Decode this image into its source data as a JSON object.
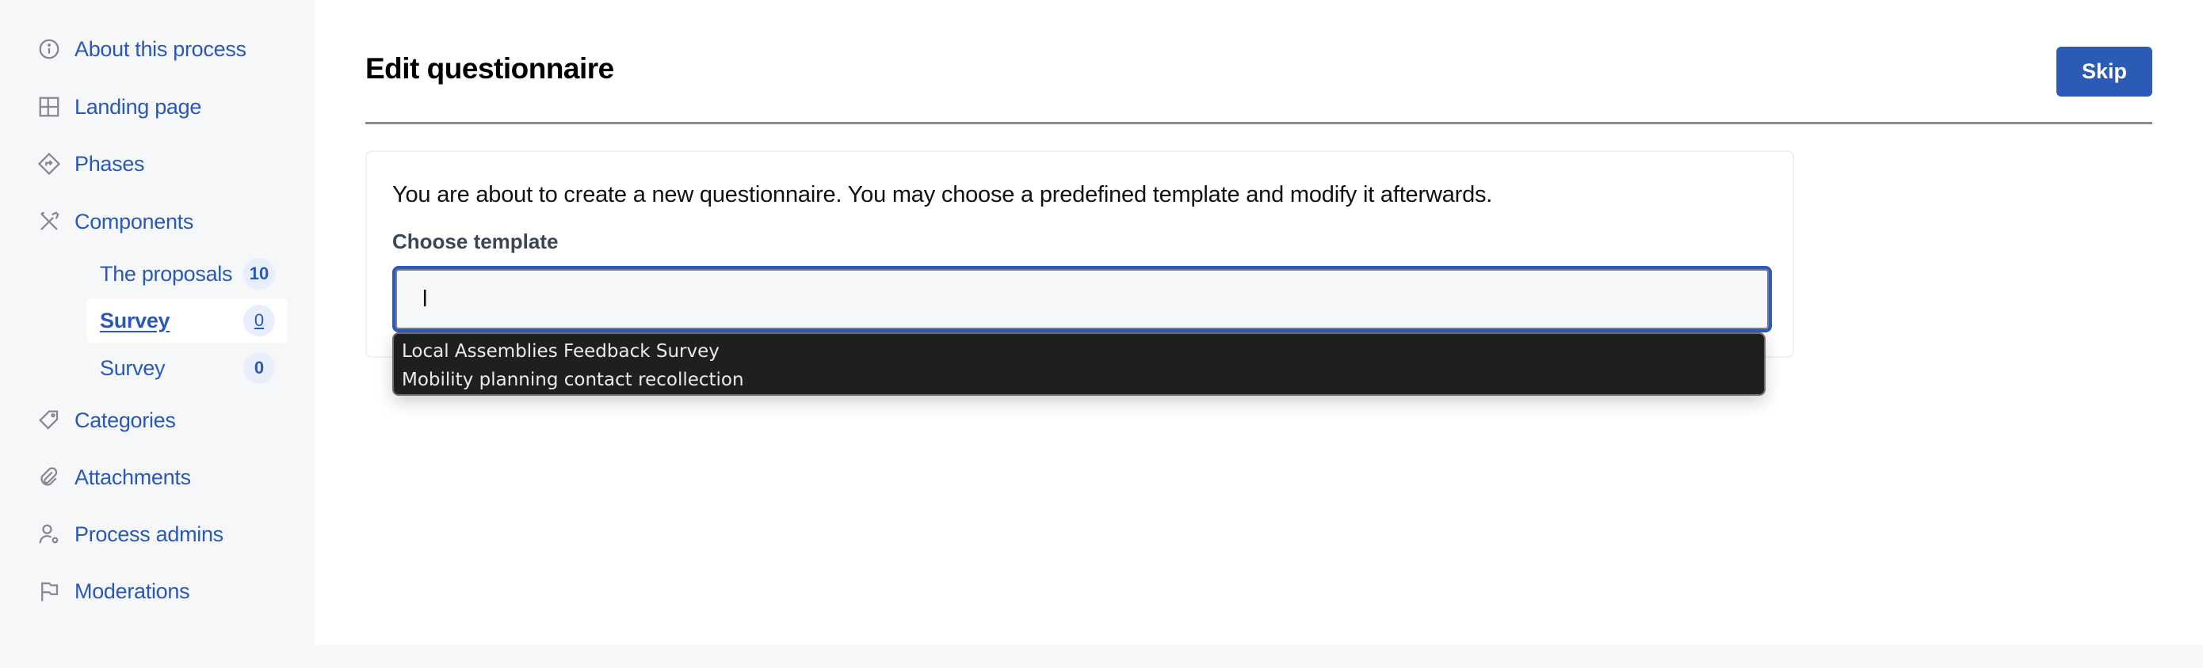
{
  "sidebar": {
    "items": [
      {
        "label": "About this process",
        "icon": "info-icon"
      },
      {
        "label": "Landing page",
        "icon": "layout-icon"
      },
      {
        "label": "Phases",
        "icon": "direction-sign-icon"
      },
      {
        "label": "Components",
        "icon": "tools-icon"
      },
      {
        "label": "Categories",
        "icon": "tag-icon"
      },
      {
        "label": "Attachments",
        "icon": "paperclip-icon"
      },
      {
        "label": "Process admins",
        "icon": "user-settings-icon"
      },
      {
        "label": "Moderations",
        "icon": "flag-icon"
      }
    ],
    "components": [
      {
        "label": "The proposals",
        "count": "10",
        "active": false
      },
      {
        "label": "Survey",
        "count": "0",
        "active": true
      },
      {
        "label": "Survey",
        "count": "0",
        "active": false
      }
    ]
  },
  "header": {
    "title": "Edit questionnaire",
    "skip_label": "Skip"
  },
  "form": {
    "intro": "You are about to create a new questionnaire. You may choose a predefined template and modify it afterwards.",
    "template_label": "Choose template",
    "template_value": "l",
    "suggestions": [
      "Local Assemblies Feedback Survey",
      "Mobility planning contact recollection"
    ]
  },
  "colors": {
    "accent": "#2c5bb7",
    "link": "#2a58b5",
    "sidebar_bg": "#f6f7f9",
    "badge_bg": "#e8eefb"
  }
}
